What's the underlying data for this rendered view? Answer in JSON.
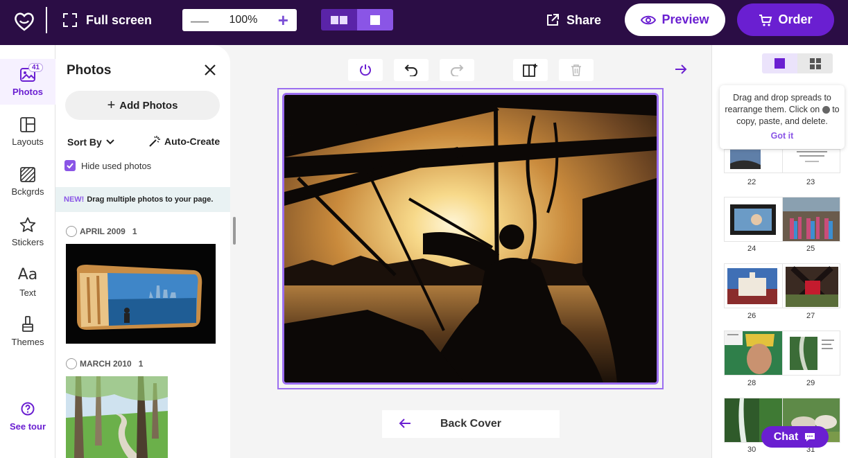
{
  "topbar": {
    "fullscreen_label": "Full screen",
    "zoom_value": "100%",
    "share_label": "Share",
    "preview_label": "Preview",
    "order_label": "Order"
  },
  "rail": {
    "photos": {
      "label": "Photos",
      "badge": "41"
    },
    "layouts": "Layouts",
    "backgrounds": "Bckgrds",
    "stickers": "Stickers",
    "text": "Text",
    "themes": "Themes",
    "see_tour": "See tour"
  },
  "panel": {
    "title": "Photos",
    "add_photos": "Add Photos",
    "sort_by": "Sort By",
    "auto_create": "Auto-Create",
    "hide_used": "Hide used photos",
    "banner_new": "NEW!",
    "banner_text": "Drag multiple photos to your page.",
    "groups": [
      {
        "label": "APRIL 2009",
        "count": "1"
      },
      {
        "label": "MARCH 2010",
        "count": "1"
      }
    ]
  },
  "canvas": {
    "back_cover": "Back Cover"
  },
  "right": {
    "tip_line1": "Drag and drop spreads to rearrange them. Click on",
    "tip_line2": "to copy, paste, and delete.",
    "got_it": "Got it",
    "pages": [
      "22",
      "23",
      "24",
      "25",
      "26",
      "27",
      "28",
      "29",
      "30",
      "31"
    ]
  },
  "chat_label": "Chat",
  "colors": {
    "brand_dark": "#2b0d45",
    "accent": "#6a1fd1",
    "accent_light": "#8a55e6"
  }
}
